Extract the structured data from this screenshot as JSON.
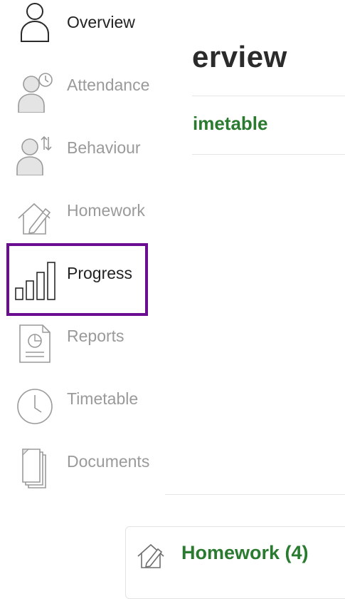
{
  "page": {
    "title_fragment": "erview",
    "timetable_fragment": "imetable",
    "homework_card": {
      "title": "Homework (4)"
    }
  },
  "sidebar": {
    "items": [
      {
        "label": "Overview",
        "icon": "person-icon"
      },
      {
        "label": "Attendance",
        "icon": "person-clock-icon"
      },
      {
        "label": "Behaviour",
        "icon": "person-arrows-icon"
      },
      {
        "label": "Homework",
        "icon": "house-pencil-icon"
      },
      {
        "label": "Progress",
        "icon": "bar-chart-icon"
      },
      {
        "label": "Reports",
        "icon": "report-chart-icon"
      },
      {
        "label": "Timetable",
        "icon": "clock-icon"
      },
      {
        "label": "Documents",
        "icon": "documents-icon"
      }
    ]
  },
  "colors": {
    "highlight": "#6a0d91",
    "accent_green": "#2a7a30",
    "muted_text": "#9a9a9a"
  }
}
